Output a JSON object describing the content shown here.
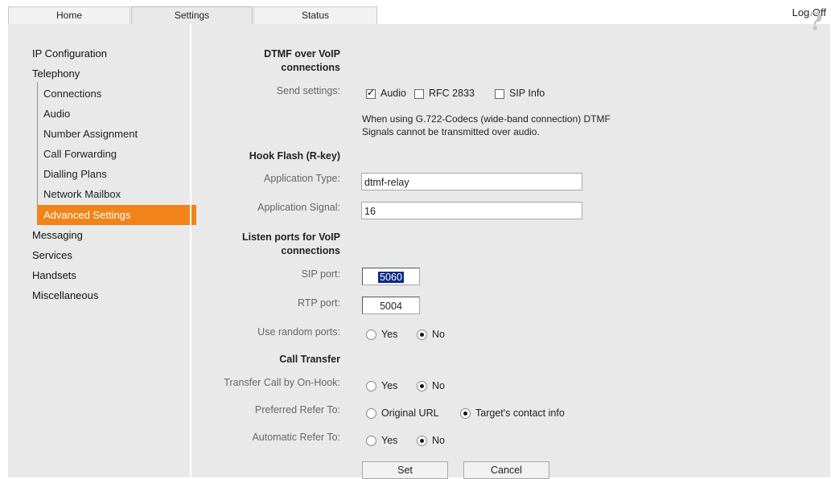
{
  "tabs": {
    "home": "Home",
    "settings": "Settings",
    "status": "Status"
  },
  "logoff": "Log Off",
  "help_symbol": "?",
  "sidebar": {
    "ip_configuration": "IP Configuration",
    "telephony": "Telephony",
    "sub": {
      "connections": "Connections",
      "audio": "Audio",
      "number_assignment": "Number Assignment",
      "call_forwarding": "Call Forwarding",
      "dialling_plans": "Dialling Plans",
      "network_mailbox": "Network Mailbox",
      "advanced_settings": "Advanced Settings"
    },
    "messaging": "Messaging",
    "services": "Services",
    "handsets": "Handsets",
    "miscellaneous": "Miscellaneous"
  },
  "dtmf": {
    "title_line1": "DTMF over VoIP",
    "title_line2": "connections",
    "send_settings_label": "Send settings:",
    "audio_label": "Audio",
    "rfc_label": "RFC 2833",
    "sip_info_label": "SIP Info",
    "note_line1": "When using G.722-Codecs (wide-band connection) DTMF",
    "note_line2": "Signals cannot be transmitted over audio."
  },
  "hook_flash": {
    "title": "Hook Flash (R-key)",
    "app_type_label": "Application Type:",
    "app_type_value": "dtmf-relay",
    "app_signal_label": "Application Signal:",
    "app_signal_value": "16"
  },
  "listen_ports": {
    "title_line1": "Listen ports for VoIP",
    "title_line2": "connections",
    "sip_port_label": "SIP port:",
    "sip_port_value": "5060",
    "rtp_port_label": "RTP port:",
    "rtp_port_value": "5004",
    "random_ports_label": "Use random ports:",
    "yes": "Yes",
    "no": "No"
  },
  "call_transfer": {
    "title": "Call Transfer",
    "on_hook_label": "Transfer Call by On-Hook:",
    "preferred_refer_label": "Preferred Refer To:",
    "original_url": "Original URL",
    "targets_contact": "Target's contact info",
    "automatic_refer_label": "Automatic Refer To:",
    "yes": "Yes",
    "no": "No"
  },
  "buttons": {
    "set": "Set",
    "cancel": "Cancel"
  }
}
